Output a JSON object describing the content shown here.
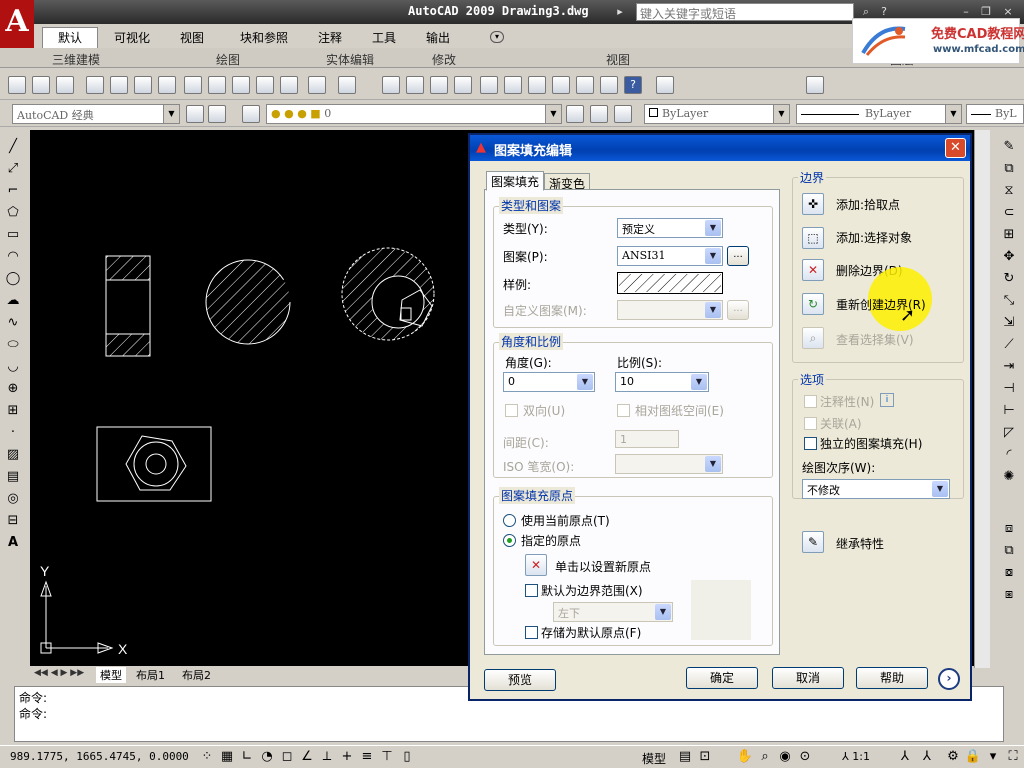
{
  "window": {
    "title": "AutoCAD 2009 Drawing3.dwg",
    "search_placeholder": "键入关键字或短语"
  },
  "watermark": {
    "name": "免费CAD教程网",
    "url": "www.mfcad.com"
  },
  "ribbon": {
    "tabs": [
      "默认",
      "可视化",
      "视图",
      "块和参照",
      "注释",
      "工具",
      "输出"
    ],
    "panels": [
      "三维建模",
      "绘图",
      "实体编辑",
      "修改",
      "视图",
      "图层"
    ]
  },
  "toolbar2": {
    "workspace": "AutoCAD 经典",
    "layer_value": "0",
    "color": "ByLayer",
    "linetype": "ByLayer",
    "lineweight": "ByL"
  },
  "layout_tabs": [
    "模型",
    "布局1",
    "布局2"
  ],
  "axis": {
    "y": "Y",
    "x": "X"
  },
  "command": {
    "line1": "命令:",
    "line2": "命令:"
  },
  "status": {
    "coords": "989.1775,  1665.4745, 0.0000",
    "model": "模型",
    "scale": "1:1"
  },
  "dialog": {
    "title": "图案填充编辑",
    "tabs": [
      "图案填充",
      "渐变色"
    ],
    "type_pattern": {
      "title": "类型和图案",
      "type_label": "类型(Y):",
      "type_value": "预定义",
      "pattern_label": "图案(P):",
      "pattern_value": "ANSI31",
      "pattern_more": "...",
      "sample_label": "样例:",
      "custom_label": "自定义图案(M):",
      "custom_more": "..."
    },
    "angle_scale": {
      "title": "角度和比例",
      "angle_label": "角度(G):",
      "angle_value": "0",
      "scale_label": "比例(S):",
      "scale_value": "10",
      "double_label": "双向(U)",
      "relative_label": "相对图纸空间(E)",
      "spacing_label": "间距(C):",
      "spacing_value": "1",
      "iso_label": "ISO 笔宽(O):"
    },
    "origin": {
      "title": "图案填充原点",
      "current_label": "使用当前原点(T)",
      "specified_label": "指定的原点",
      "click_label": "单击以设置新原点",
      "default_extents_label": "默认为边界范围(X)",
      "position_value": "左下",
      "store_label": "存储为默认原点(F)"
    },
    "boundaries": {
      "title": "边界",
      "add_pick": "添加:拾取点",
      "add_select": "添加:选择对象",
      "remove": "删除边界(D)",
      "recreate": "重新创建边界(R)",
      "view": "查看选择集(V)"
    },
    "options": {
      "title": "选项",
      "annotative": "注释性(N)",
      "associative": "关联(A)",
      "independent": "独立的图案填充(H)",
      "draw_order_label": "绘图次序(W):",
      "draw_order_value": "不修改"
    },
    "inherit": "继承特性",
    "buttons": {
      "preview": "预览",
      "ok": "确定",
      "cancel": "取消",
      "help": "帮助"
    }
  },
  "colors": {
    "accent": "#0a58d8",
    "canvas": "#000000",
    "highlight": "#fff000"
  }
}
